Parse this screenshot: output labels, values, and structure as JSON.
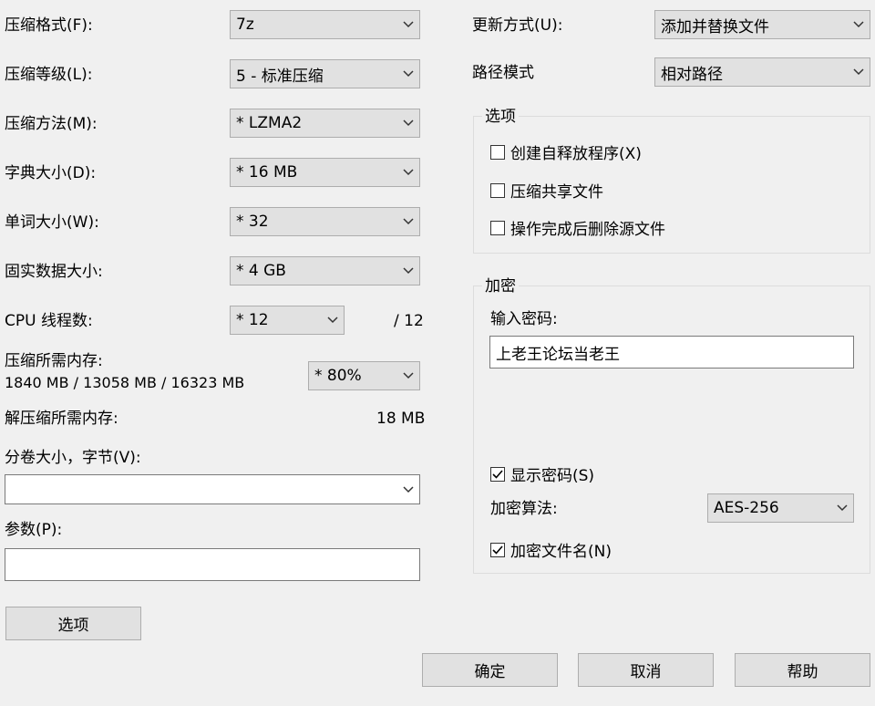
{
  "left": {
    "format_label": "压缩格式(F):",
    "format_value": "7z",
    "level_label": "压缩等级(L):",
    "level_value": "5 - 标准压缩",
    "method_label": "压缩方法(M):",
    "method_value": "* LZMA2",
    "dict_label": "字典大小(D):",
    "dict_value": "* 16 MB",
    "word_label": "单词大小(W):",
    "word_value": "* 32",
    "solid_label": "固实数据大小:",
    "solid_value": "* 4 GB",
    "threads_label": "CPU 线程数:",
    "threads_value": "* 12",
    "threads_total": "/ 12",
    "mem_label": "压缩所需内存:",
    "mem_detail": "1840 MB / 13058 MB / 16323 MB",
    "mem_value": "* 80%",
    "decomp_label": "解压缩所需内存:",
    "decomp_value": "18 MB",
    "volume_label": "分卷大小，字节(V):",
    "volume_value": "",
    "params_label": "参数(P):",
    "params_value": "",
    "options_button": "选项"
  },
  "right": {
    "update_label": "更新方式(U):",
    "update_value": "添加并替换文件",
    "path_label": "路径模式",
    "path_value": "相对路径",
    "options_group": "选项",
    "opt_sfx": "创建自释放程序(X)",
    "opt_shared": "压缩共享文件",
    "opt_delete": "操作完成后删除源文件",
    "encrypt_group": "加密",
    "password_label": "输入密码:",
    "password_value": "上老王论坛当老王",
    "show_password": "显示密码(S)",
    "algo_label": "加密算法:",
    "algo_value": "AES-256",
    "encrypt_names": "加密文件名(N)"
  },
  "buttons": {
    "ok": "确定",
    "cancel": "取消",
    "help": "帮助"
  }
}
